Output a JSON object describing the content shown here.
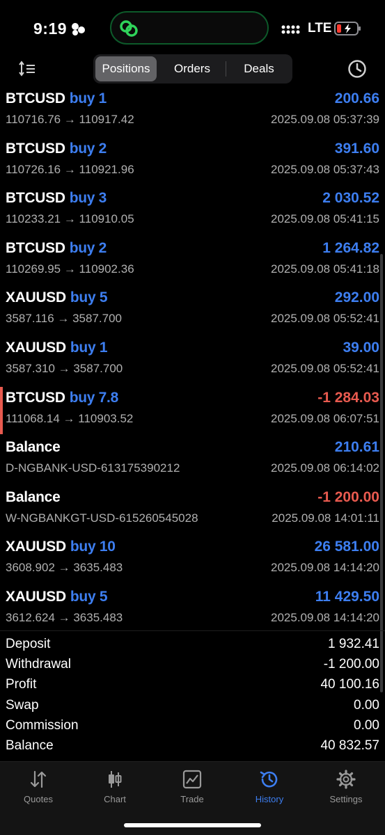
{
  "status": {
    "time": "9:19",
    "network": "LTE"
  },
  "toolbar": {
    "tabs": [
      {
        "label": "Positions",
        "active": true
      },
      {
        "label": "Orders",
        "active": false
      },
      {
        "label": "Deals",
        "active": false
      }
    ]
  },
  "rows": [
    {
      "symbol": "BTCUSD",
      "side": "buy 1",
      "amount": "200.66",
      "negative": false,
      "prices": "110716.76 → 110917.42",
      "time": "2025.09.08 05:37:39"
    },
    {
      "symbol": "BTCUSD",
      "side": "buy 2",
      "amount": "391.60",
      "negative": false,
      "prices": "110726.16 → 110921.96",
      "time": "2025.09.08 05:37:43"
    },
    {
      "symbol": "BTCUSD",
      "side": "buy 3",
      "amount": "2 030.52",
      "negative": false,
      "prices": "110233.21 → 110910.05",
      "time": "2025.09.08 05:41:15"
    },
    {
      "symbol": "BTCUSD",
      "side": "buy 2",
      "amount": "1 264.82",
      "negative": false,
      "prices": "110269.95 → 110902.36",
      "time": "2025.09.08 05:41:18"
    },
    {
      "symbol": "XAUUSD",
      "side": "buy 5",
      "amount": "292.00",
      "negative": false,
      "prices": "3587.116 → 3587.700",
      "time": "2025.09.08 05:52:41"
    },
    {
      "symbol": "XAUUSD",
      "side": "buy 1",
      "amount": "39.00",
      "negative": false,
      "prices": "3587.310 → 3587.700",
      "time": "2025.09.08 05:52:41"
    },
    {
      "symbol": "BTCUSD",
      "side": "buy 7.8",
      "amount": "-1 284.03",
      "negative": true,
      "prices": "111068.14 → 110903.52",
      "time": "2025.09.08 06:07:51"
    },
    {
      "symbol": "Balance",
      "side": "",
      "amount": "210.61",
      "negative": false,
      "prices": "D-NGBANK-USD-613175390212",
      "time": "2025.09.08 06:14:02"
    },
    {
      "symbol": "Balance",
      "side": "",
      "amount": "-1 200.00",
      "negative": true,
      "prices": "W-NGBANKGT-USD-615260545028",
      "time": "2025.09.08 14:01:11"
    },
    {
      "symbol": "XAUUSD",
      "side": "buy 10",
      "amount": "26 581.00",
      "negative": false,
      "prices": "3608.902 → 3635.483",
      "time": "2025.09.08 14:14:20"
    },
    {
      "symbol": "XAUUSD",
      "side": "buy 5",
      "amount": "11 429.50",
      "negative": false,
      "prices": "3612.624 → 3635.483",
      "time": "2025.09.08 14:14:20"
    }
  ],
  "summary": [
    {
      "label": "Deposit",
      "value": "1 932.41"
    },
    {
      "label": "Withdrawal",
      "value": "-1 200.00"
    },
    {
      "label": "Profit",
      "value": "40 100.16"
    },
    {
      "label": "Swap",
      "value": "0.00"
    },
    {
      "label": "Commission",
      "value": "0.00"
    },
    {
      "label": "Balance",
      "value": "40 832.57"
    }
  ],
  "tabbar": [
    {
      "label": "Quotes",
      "icon": "quotes-icon",
      "active": false
    },
    {
      "label": "Chart",
      "icon": "chart-icon",
      "active": false
    },
    {
      "label": "Trade",
      "icon": "trade-icon",
      "active": false
    },
    {
      "label": "History",
      "icon": "history-icon",
      "active": true
    },
    {
      "label": "Settings",
      "icon": "settings-icon",
      "active": false
    }
  ],
  "colors": {
    "accent": "#3d7ef0",
    "negative": "#e85a4f",
    "background": "#000000"
  }
}
